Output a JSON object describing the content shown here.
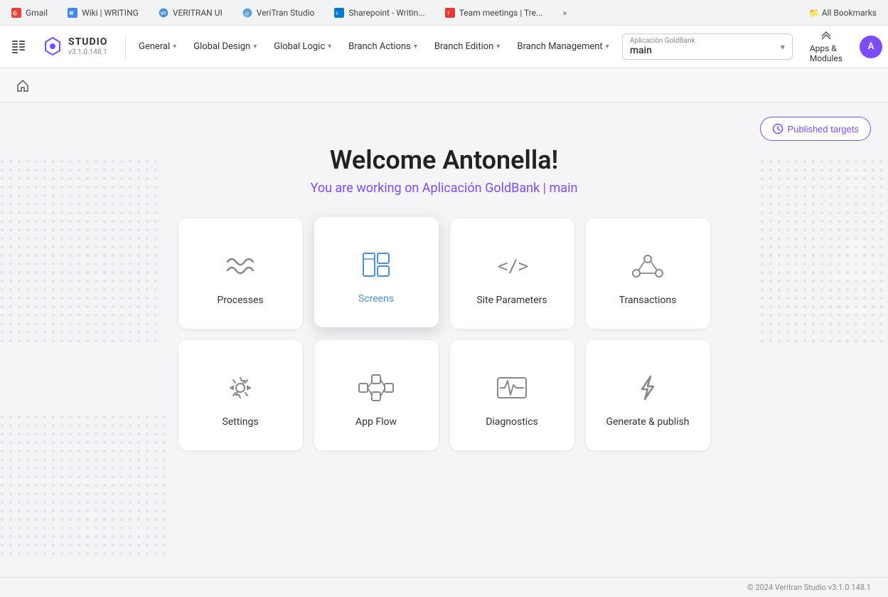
{
  "browser": {
    "tabs": [
      {
        "id": "gmail",
        "label": "Gmail",
        "color": "#EA4335"
      },
      {
        "id": "wiki-writing",
        "label": "Wiki | WRITING",
        "color": "#4285F4"
      },
      {
        "id": "veritran-ui",
        "label": "VERITRAN UI",
        "color": "#4a90d9"
      },
      {
        "id": "veritran-studio",
        "label": "VeriTran Studio",
        "color": "#5a9fd4"
      },
      {
        "id": "sharepoint",
        "label": "Sharepoint - Writin...",
        "color": "#0078D4"
      },
      {
        "id": "team-meetings",
        "label": "Team meetings | Tre...",
        "color": "#E53935"
      }
    ],
    "more_label": "»",
    "bookmarks_label": "All Bookmarks"
  },
  "toolbar": {
    "logo_title": "STUDIO",
    "logo_version": "v3.1.0.148.1",
    "menus": [
      {
        "id": "general",
        "label": "General"
      },
      {
        "id": "global-design",
        "label": "Global Design"
      },
      {
        "id": "global-logic",
        "label": "Global Logic"
      },
      {
        "id": "branch-actions",
        "label": "Branch Actions"
      },
      {
        "id": "branch-edition",
        "label": "Branch Edition"
      },
      {
        "id": "branch-management",
        "label": "Branch Management"
      }
    ],
    "app_selector_label": "Aplicación GoldBank",
    "app_selector_value": "main",
    "apps_modules_label": "Apps &\nModules",
    "user_initial": "A"
  },
  "secondary_toolbar": {
    "home_tooltip": "Home"
  },
  "main": {
    "published_targets_label": "Published targets",
    "welcome_title": "Welcome Antonella!",
    "welcome_subtitle": "You are working on Aplicación GoldBank | main",
    "cards": [
      {
        "id": "processes",
        "label": "Processes",
        "icon": "processes-icon"
      },
      {
        "id": "screens",
        "label": "Screens",
        "icon": "screens-icon",
        "active": true
      },
      {
        "id": "site-parameters",
        "label": "Site Parameters",
        "icon": "site-parameters-icon"
      },
      {
        "id": "transactions",
        "label": "Transactions",
        "icon": "transactions-icon"
      },
      {
        "id": "settings",
        "label": "Settings",
        "icon": "settings-icon"
      },
      {
        "id": "app-flow",
        "label": "App Flow",
        "icon": "app-flow-icon"
      },
      {
        "id": "diagnostics",
        "label": "Diagnostics",
        "icon": "diagnostics-icon"
      },
      {
        "id": "generate-publish",
        "label": "Generate & publish",
        "icon": "generate-publish-icon"
      }
    ]
  },
  "footer": {
    "copyright": "© 2024 Veritran Studio v3.1.0.148.1"
  }
}
